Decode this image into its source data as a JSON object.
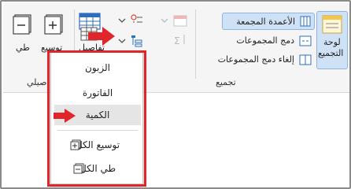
{
  "ribbon": {
    "partial_label_left": "طي",
    "expand_button": "توسيع",
    "collapse_group_partial": "صيلي",
    "details_partial": "تفاصيل",
    "grouped_columns": "الأعمدة المجمعة",
    "merge_groups": "دمج المجموعات",
    "unmerge_groups": "إلغاء دمج المجموعات",
    "group_section": "تجميع",
    "grouping_panel_line1": "لوحة",
    "grouping_panel_line2": "التجميع"
  },
  "menu": {
    "items": [
      "الزبون",
      "الفاتورة",
      "الكمية"
    ],
    "selected_index": 2,
    "actions": [
      "توسيع الكل",
      "طي الكل"
    ]
  },
  "colors": {
    "accent_red": "#e0252b",
    "selected_highlight": "#cfe1f5"
  }
}
